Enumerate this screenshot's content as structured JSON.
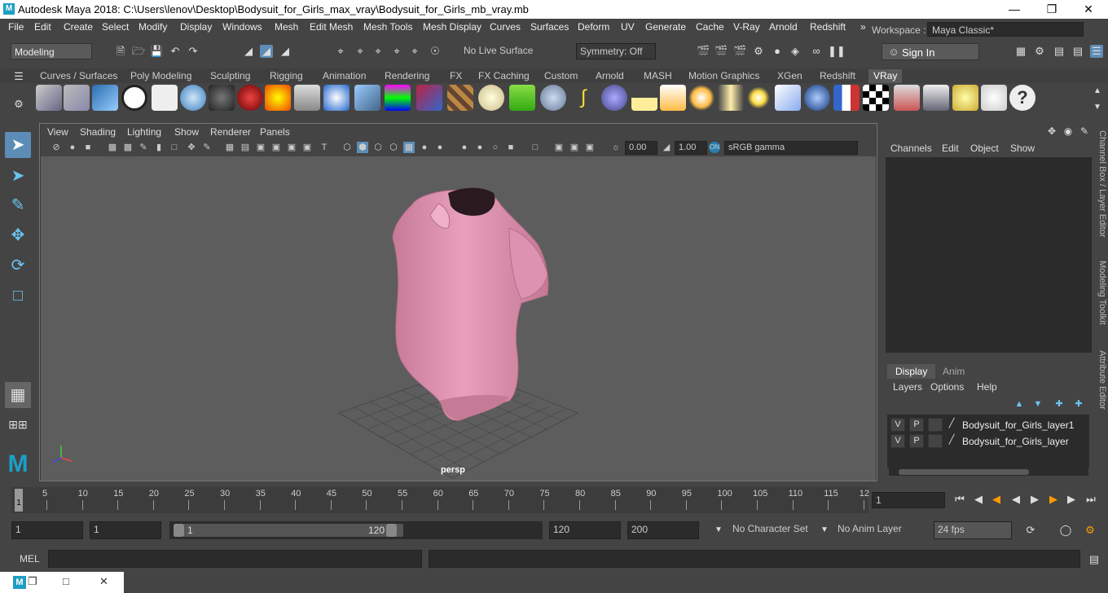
{
  "window": {
    "title": "Autodesk Maya 2018: C:\\Users\\lenov\\Desktop\\Bodysuit_for_Girls_max_vray\\Bodysuit_for_Girls_mb_vray.mb",
    "app_icon": "M"
  },
  "menubar": {
    "items": [
      "File",
      "Edit",
      "Create",
      "Select",
      "Modify",
      "Display",
      "Windows",
      "Mesh",
      "Edit Mesh",
      "Mesh Tools",
      "Mesh Display",
      "Curves",
      "Surfaces",
      "Deform",
      "UV",
      "Generate",
      "Cache",
      "V-Ray",
      "Arnold",
      "Redshift"
    ]
  },
  "workspace": {
    "label": "Workspace :",
    "value": "Maya Classic*"
  },
  "toolbar": {
    "mode": "Modeling",
    "live_surface": "No Live Surface",
    "symmetry": "Symmetry: Off",
    "sign_in": "Sign In"
  },
  "shelf": {
    "tabs": [
      "Curves / Surfaces",
      "Poly Modeling",
      "Sculpting",
      "Rigging",
      "Animation",
      "Rendering",
      "FX",
      "FX Caching",
      "Custom",
      "Arnold",
      "MASH",
      "Motion Graphics",
      "XGen",
      "Redshift",
      "VRay"
    ],
    "active_tab": "VRay"
  },
  "viewport": {
    "menus": [
      "View",
      "Shading",
      "Lighting",
      "Show",
      "Renderer",
      "Panels"
    ],
    "exposure": "0.00",
    "gamma": "1.00",
    "color_space": "sRGB gamma",
    "camera_label": "persp",
    "object_color": "#d88aa8"
  },
  "channel_box": {
    "menus": [
      "Channels",
      "Edit",
      "Object",
      "Show"
    ]
  },
  "layer_editor": {
    "tabs": [
      "Display",
      "Anim"
    ],
    "menus": [
      "Layers",
      "Options",
      "Help"
    ],
    "layers": [
      {
        "v": "V",
        "p": "P",
        "name": "Bodysuit_for_Girls_layer1"
      },
      {
        "v": "V",
        "p": "P",
        "name": "Bodysuit_for_Girls_layer"
      }
    ]
  },
  "side_tabs": [
    "Channel Box / Layer Editor",
    "Modeling Toolkit",
    "Attribute Editor"
  ],
  "timeline": {
    "ticks": [
      "5",
      "10",
      "15",
      "20",
      "25",
      "30",
      "35",
      "40",
      "45",
      "50",
      "55",
      "60",
      "65",
      "70",
      "75",
      "80",
      "85",
      "90",
      "95",
      "100",
      "105",
      "110",
      "115",
      "12"
    ],
    "current_frame_marker": "1",
    "current_frame": "1"
  },
  "range": {
    "start": "1",
    "inner_start": "1",
    "slider_start": "1",
    "slider_end": "120",
    "end": "120",
    "outer_end": "200",
    "character_set": "No Character Set",
    "anim_layer": "No Anim Layer",
    "fps": "24 fps"
  },
  "command_line": {
    "label": "MEL"
  }
}
